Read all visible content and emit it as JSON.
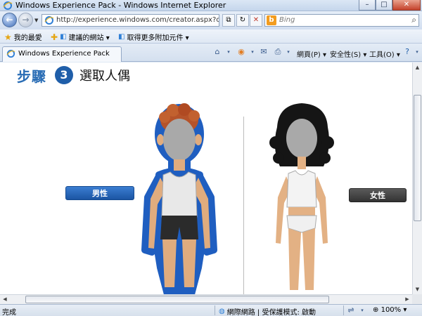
{
  "window": {
    "title": "Windows Experience Pack - Windows Internet Explorer"
  },
  "address": {
    "url": "http://experience.windows.com/creator.aspx?culture",
    "search_placeholder": "Bing"
  },
  "favorites": {
    "favorites_label": "我的最愛",
    "suggested_sites": "建議的網站 ▾",
    "addons": "取得更多附加元件 ▾"
  },
  "tab": {
    "label": "Windows Experience Pack"
  },
  "commands": {
    "page": "網頁(P) ▾",
    "safety": "安全性(S) ▾",
    "tools": "工具(O) ▾"
  },
  "content": {
    "step_word": "步驟",
    "step_number": "3",
    "step_title": "選取人偶",
    "male_label": "男性",
    "female_label": "女性"
  },
  "status": {
    "text": "完成",
    "zone": "網際網路 | 受保護模式: 啟動",
    "zoom": "100%"
  },
  "colors": {
    "accent": "#2a6db5",
    "male_button": "#1b55a3",
    "female_button": "#333333",
    "male_outline": "#1f5ec0"
  }
}
